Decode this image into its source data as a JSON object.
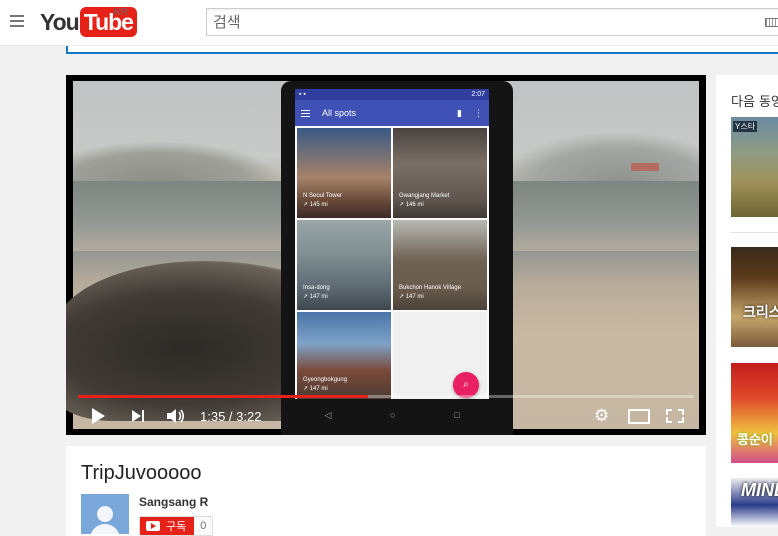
{
  "masthead": {
    "logo_you": "You",
    "logo_tube": "Tube",
    "region": "KR",
    "search_placeholder": "검색"
  },
  "player": {
    "current_time": "1:35",
    "duration": "3:22",
    "time_display": "1:35 / 3:22",
    "progress_fraction": 0.47,
    "phone_screen": {
      "status_time": "2:07",
      "app_title": "All spots",
      "tiles": [
        {
          "name": "N Seoul Tower",
          "distance": "↗ 145 mi"
        },
        {
          "name": "Gwangjang Market",
          "distance": "↗ 146 mi"
        },
        {
          "name": "Insa-dong",
          "distance": "↗ 147 mi"
        },
        {
          "name": "Bukchon Hanok Village",
          "distance": "↗ 147 mi"
        },
        {
          "name": "Gyeongbokgung",
          "distance": "↗ 147 mi"
        },
        {
          "name": "",
          "distance": ""
        }
      ]
    }
  },
  "video": {
    "title": "TripJuvooooo",
    "owner": "Sangsang R",
    "subscribe_label": "구독",
    "subscriber_count": "0"
  },
  "sidebar": {
    "heading": "다음 동영상",
    "thumbnails": [
      {
        "overlay": "Y스타"
      },
      {
        "overlay": "크리스마스"
      },
      {
        "overlay": "콩순이"
      },
      {
        "overlay": "MINE"
      }
    ]
  },
  "colors": {
    "brand_red": "#e62117",
    "app_bar": "#3f51b5",
    "fab": "#e91e63"
  }
}
